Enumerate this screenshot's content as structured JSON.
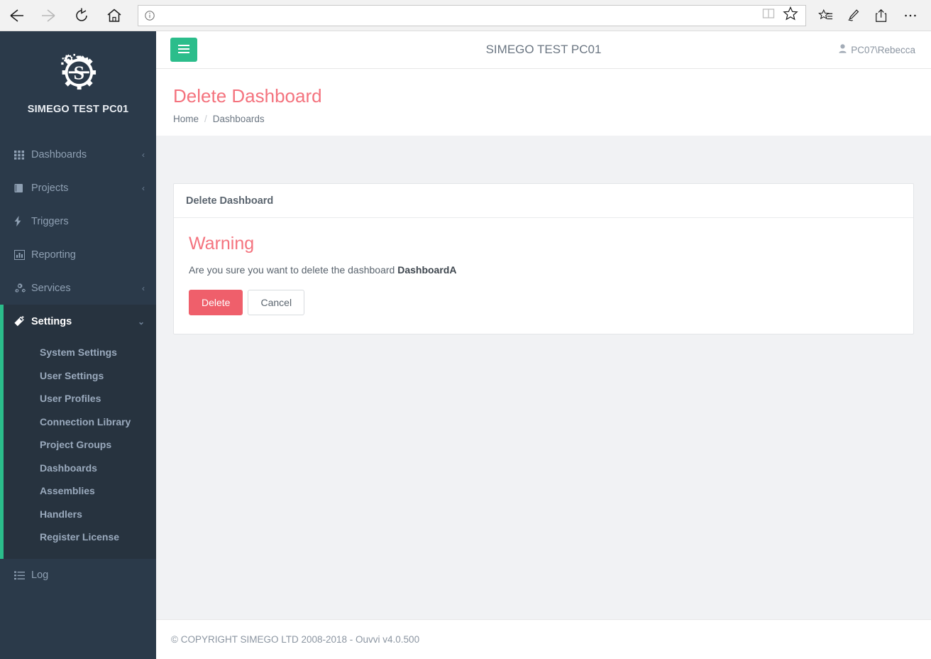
{
  "browser": {
    "back_label": "Back",
    "forward_label": "Forward",
    "refresh_label": "Refresh",
    "home_label": "Home",
    "address_value": "",
    "address_placeholder": "",
    "info_icon": "info-icon",
    "reading_view_label": "Reading view",
    "favorite_label": "Add to favorites",
    "hub_label": "Hub",
    "web_note_label": "Make a Web Note",
    "share_label": "Share",
    "more_label": "More"
  },
  "sidebar": {
    "brand_name": "SIMEGO TEST PC01",
    "items": [
      {
        "label": "Dashboards",
        "icon": "grid-icon",
        "chevron": "‹",
        "active": false
      },
      {
        "label": "Projects",
        "icon": "book-icon",
        "chevron": "‹",
        "active": false
      },
      {
        "label": "Triggers",
        "icon": "bolt-icon",
        "chevron": "",
        "active": false
      },
      {
        "label": "Reporting",
        "icon": "bar-chart-icon",
        "chevron": "",
        "active": false
      },
      {
        "label": "Services",
        "icon": "cogs-icon",
        "chevron": "‹",
        "active": false
      },
      {
        "label": "Settings",
        "icon": "magic-wand-icon",
        "chevron": "⌄",
        "active": true
      }
    ],
    "submenu": [
      "System Settings",
      "User Settings",
      "User Profiles",
      "Connection Library",
      "Project Groups",
      "Dashboards",
      "Assemblies",
      "Handlers",
      "Register License"
    ],
    "log_label": "Log",
    "log_icon": "list-icon",
    "accent_color": "#2bbd8b",
    "background_color": "#2b3a4a"
  },
  "topbar": {
    "menu_toggle_label": "Toggle navigation",
    "title": "SIMEGO TEST PC01",
    "user": "PC07\\Rebecca",
    "user_icon": "user-icon"
  },
  "page": {
    "title": "Delete Dashboard",
    "title_color": "#f4737e",
    "breadcrumb": {
      "home": "Home",
      "separator": "/",
      "current": "Dashboards"
    }
  },
  "card": {
    "header": "Delete Dashboard",
    "warning_heading": "Warning",
    "message_prefix": "Are you sure you want to delete the dashboard ",
    "target_name": "DashboardA",
    "delete_label": "Delete",
    "cancel_label": "Cancel",
    "delete_color": "#ef5f6b"
  },
  "footer": {
    "text": "© COPYRIGHT SIMEGO LTD 2008-2018 - Ouvvi v4.0.500"
  }
}
